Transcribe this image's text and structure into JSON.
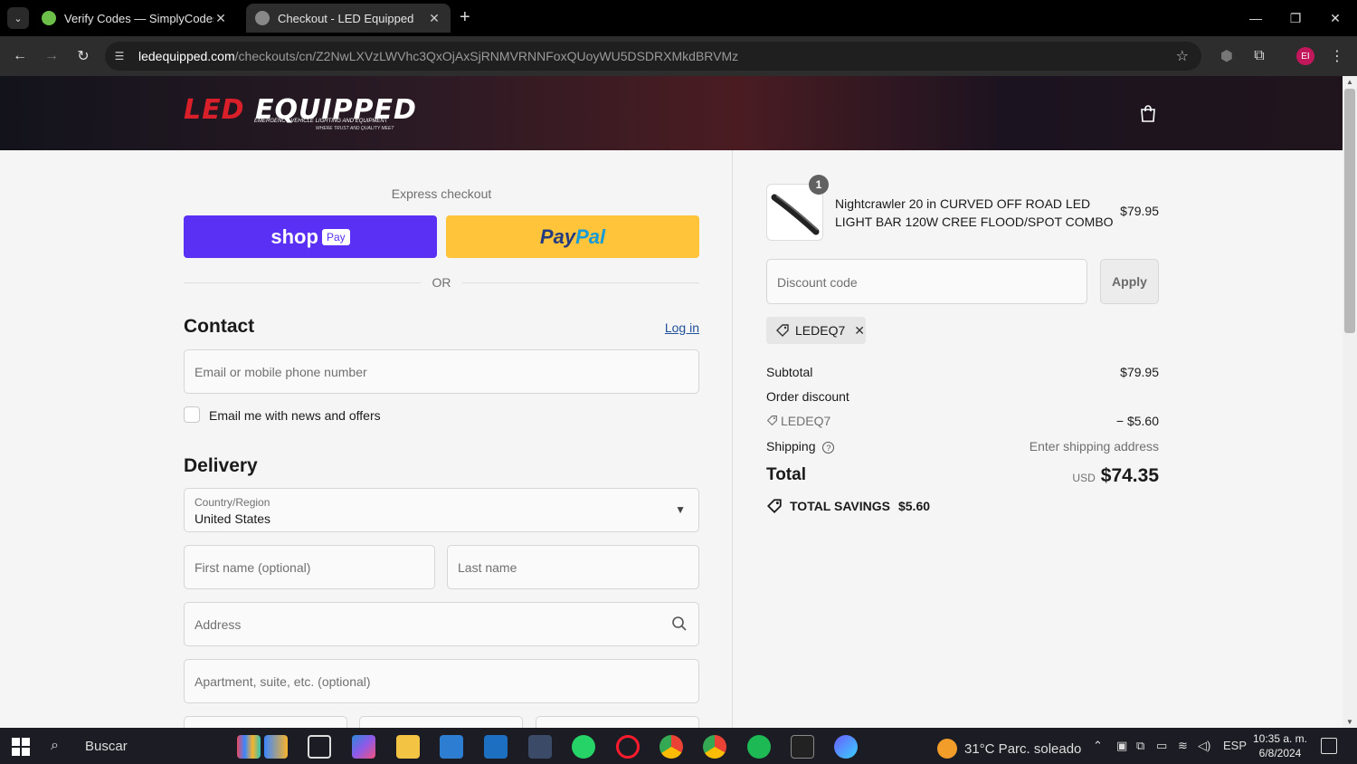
{
  "browser": {
    "tabs": [
      {
        "title": "Verify Codes — SimplyCodes",
        "close": "✕"
      },
      {
        "title": "Checkout - LED Equipped",
        "close": "✕"
      }
    ],
    "new_tab": "+",
    "url_domain": "ledequipped.com",
    "url_path": "/checkouts/cn/Z2NwLXVzLWVhc3QxOjAxSjRNMVRNNFoxQUoyWU5DSDRXMkdBRVMz",
    "profile_initials": "EI"
  },
  "header": {
    "logo_main_led": "LED",
    "logo_main_rest": " EQUIPPED",
    "logo_tagline": "EMERGENCY VEHICLE LIGHTING AND EQUIPMENT",
    "logo_tagline2": "WHERE TRUST AND QUALITY MEET"
  },
  "checkout": {
    "express_label": "Express checkout",
    "shop_label": "shop",
    "shop_pay": "Pay",
    "paypal_pay": "Pay",
    "paypal_pal": "Pal",
    "or_label": "OR",
    "contact_heading": "Contact",
    "login_link": "Log in",
    "email_placeholder": "Email or mobile phone number",
    "news_checkbox_label": "Email me with news and offers",
    "delivery_heading": "Delivery",
    "country_label": "Country/Region",
    "country_value": "United States",
    "first_name_placeholder": "First name (optional)",
    "last_name_placeholder": "Last name",
    "address_placeholder": "Address",
    "apartment_placeholder": "Apartment, suite, etc. (optional)"
  },
  "summary": {
    "item": {
      "quantity": "1",
      "name": "Nightcrawler 20 in CURVED OFF ROAD LED LIGHT BAR 120W CREE FLOOD/SPOT COMBO",
      "price": "$79.95"
    },
    "discount_placeholder": "Discount code",
    "apply_label": "Apply",
    "applied_code": "LEDEQ7",
    "subtotal_label": "Subtotal",
    "subtotal_value": "$79.95",
    "order_discount_label": "Order discount",
    "discount_code_line": "LEDEQ7",
    "discount_amount": "− $5.60",
    "shipping_label": "Shipping",
    "shipping_value": "Enter shipping address",
    "total_label": "Total",
    "total_currency": "USD",
    "total_value": "$74.35",
    "savings_label": "TOTAL SAVINGS",
    "savings_value": "$5.60"
  },
  "taskbar": {
    "search_label": "Buscar",
    "weather": "31°C  Parc. soleado",
    "language": "ESP",
    "time": "10:35 a. m.",
    "date": "6/8/2024"
  },
  "colors": {
    "shop_pay": "#5a31f4",
    "paypal": "#ffc439",
    "link": "#1f5199",
    "brand_red": "#d81f2a"
  }
}
